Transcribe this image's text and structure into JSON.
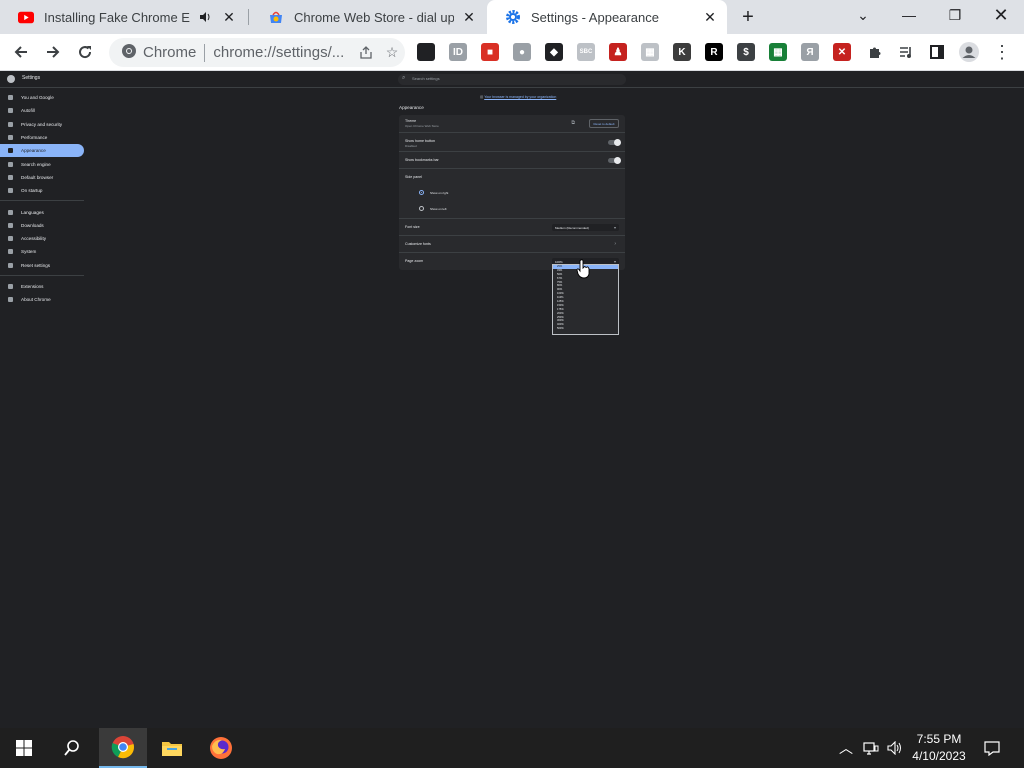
{
  "browser": {
    "tabs": [
      {
        "title": "Installing Fake Chrome Exten",
        "favicon": "youtube-icon",
        "audio": true,
        "active": false
      },
      {
        "title": "Chrome Web Store - dial up",
        "favicon": "webstore-icon",
        "active": false
      },
      {
        "title": "Settings - Appearance",
        "favicon": "gear-icon",
        "active": true
      }
    ],
    "new_tab_label": "+",
    "omnibox": {
      "chip": "Chrome",
      "url": "chrome://settings/..."
    },
    "extensions": [
      {
        "name": "hat-extension-icon",
        "color": "#202124",
        "glyph": ""
      },
      {
        "name": "id-extension-icon",
        "color": "#9aa0a6",
        "glyph": "ID"
      },
      {
        "name": "red-square-extension-icon",
        "color": "#d93025",
        "glyph": "■"
      },
      {
        "name": "globe-extension-icon",
        "color": "#9aa0a6",
        "glyph": "●"
      },
      {
        "name": "roblox-extension-icon",
        "color": "#202124",
        "glyph": "◆"
      },
      {
        "name": "sbc-extension-icon",
        "color": "#bdc1c6",
        "glyph": "SBC"
      },
      {
        "name": "figure-extension-icon",
        "color": "#c5221f",
        "glyph": "♟"
      },
      {
        "name": "box-extension-icon",
        "color": "#bdc1c6",
        "glyph": "▦"
      },
      {
        "name": "k-extension-icon",
        "color": "#3c3c3c",
        "glyph": "K"
      },
      {
        "name": "r-extension-icon",
        "color": "#000000",
        "glyph": "R"
      },
      {
        "name": "cash-extension-icon",
        "color": "#3c4043",
        "glyph": "$"
      },
      {
        "name": "grid-extension-icon",
        "color": "#188038",
        "glyph": "▦"
      },
      {
        "name": "ya-extension-icon",
        "color": "#9aa0a6",
        "glyph": "Я"
      },
      {
        "name": "sword-extension-icon",
        "color": "#c5221f",
        "glyph": "✕"
      }
    ]
  },
  "settings": {
    "header_title": "Settings",
    "search_placeholder": "Search settings",
    "nav": [
      {
        "label": "You and Google",
        "name": "nav-item-you-and-google",
        "selected": false
      },
      {
        "label": "Autofill",
        "name": "nav-item-autofill",
        "selected": false
      },
      {
        "label": "Privacy and security",
        "name": "nav-item-privacy",
        "selected": false
      },
      {
        "label": "Performance",
        "name": "nav-item-performance",
        "selected": false
      },
      {
        "label": "Appearance",
        "name": "nav-item-appearance",
        "selected": true
      },
      {
        "label": "Search engine",
        "name": "nav-item-search-engine",
        "selected": false
      },
      {
        "label": "Default browser",
        "name": "nav-item-default-browser",
        "selected": false
      },
      {
        "label": "On startup",
        "name": "nav-item-on-startup",
        "selected": false
      },
      {
        "label": "Languages",
        "name": "nav-item-languages",
        "selected": false
      },
      {
        "label": "Downloads",
        "name": "nav-item-downloads",
        "selected": false
      },
      {
        "label": "Accessibility",
        "name": "nav-item-accessibility",
        "selected": false
      },
      {
        "label": "System",
        "name": "nav-item-system",
        "selected": false
      },
      {
        "label": "Reset settings",
        "name": "nav-item-reset",
        "selected": false
      },
      {
        "label": "Extensions",
        "name": "nav-item-extensions",
        "selected": false
      },
      {
        "label": "About Chrome",
        "name": "nav-item-about",
        "selected": false
      }
    ],
    "managed_notice": "Your browser is managed by your organization",
    "section_title": "Appearance",
    "rows": {
      "theme_label": "Theme",
      "theme_sub": "Open Chrome Web Store",
      "reset_button": "Reset to default",
      "home_label": "Show home button",
      "home_sub": "Disabled",
      "bookmarks_label": "Show bookmarks bar",
      "side_panel_label": "Side panel",
      "radio_right": "Show on right",
      "radio_left": "Show on left",
      "font_size_label": "Font size",
      "font_size_value": "Medium (Recommended)",
      "customize_fonts_label": "Customize fonts",
      "page_zoom_label": "Page zoom",
      "page_zoom_value": "100%"
    },
    "zoom_options": [
      "25%",
      "33%",
      "50%",
      "67%",
      "75%",
      "80%",
      "90%",
      "100%",
      "110%",
      "125%",
      "150%",
      "175%",
      "200%",
      "250%",
      "300%",
      "400%",
      "500%"
    ],
    "zoom_selected_index": 0
  },
  "taskbar": {
    "apps": [
      "start-icon",
      "search-icon",
      "chrome-icon",
      "file-explorer-icon",
      "firefox-icon"
    ],
    "time": "7:55 PM",
    "date": "4/10/2023"
  }
}
